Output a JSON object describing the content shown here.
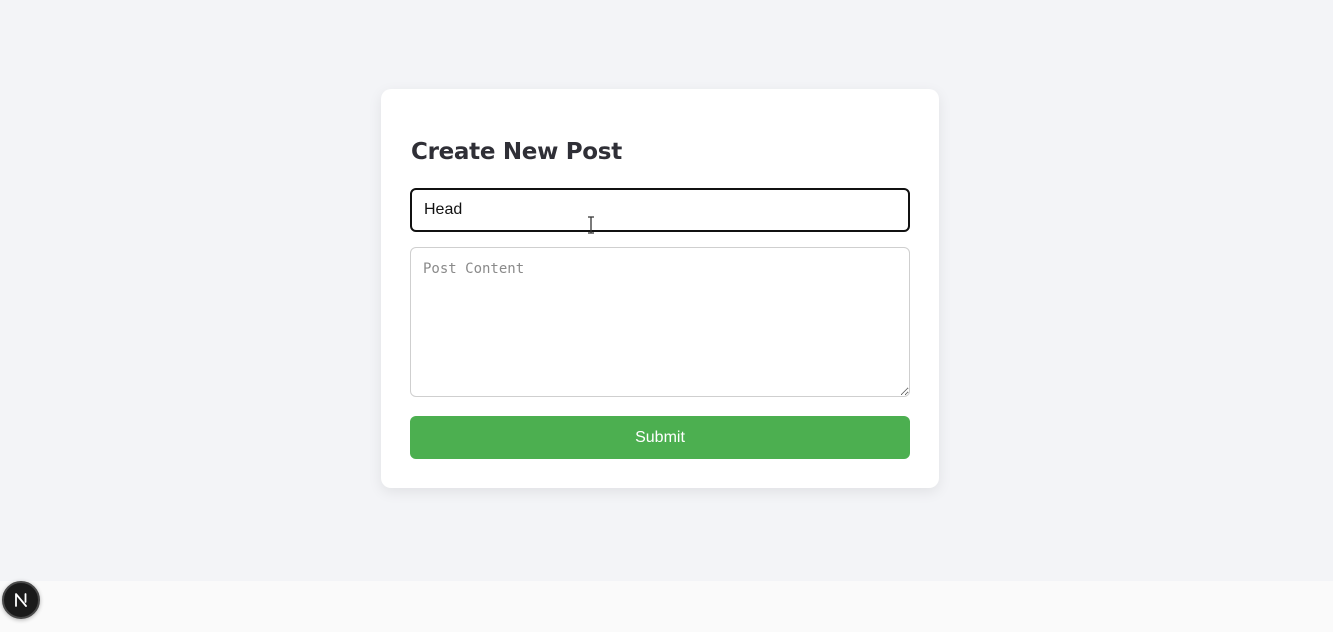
{
  "form": {
    "title": "Create New Post",
    "title_input": {
      "value": "Head"
    },
    "content_input": {
      "placeholder": "Post Content",
      "value": ""
    },
    "submit_label": "Submit"
  },
  "dev_indicator": {
    "icon": "nextjs-logo-icon",
    "letter": "N"
  },
  "colors": {
    "page_background": "#f3f4f7",
    "card_background": "#ffffff",
    "submit_button": "#4caf50",
    "submit_text": "#ffffff",
    "title_text": "#2f2f36",
    "badge_background": "#1a1a1a"
  }
}
